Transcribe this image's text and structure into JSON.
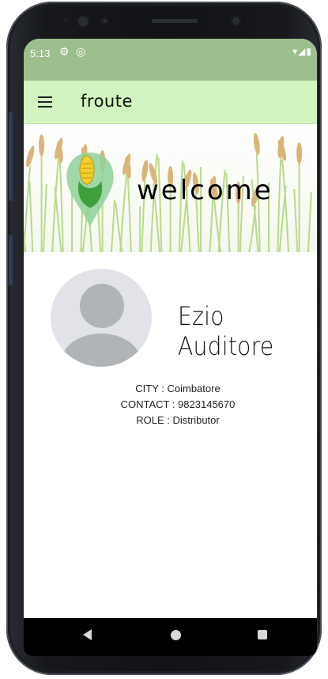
{
  "status_bar": {
    "time": "5:13",
    "icons": [
      "gear-icon",
      "sync-icon",
      "wifi-icon",
      "signal-icon",
      "battery-icon"
    ]
  },
  "app_bar": {
    "title": "froute",
    "menu_icon": "menu-icon"
  },
  "banner": {
    "text": "welcome",
    "logo_icon": "corn-pin-icon"
  },
  "profile": {
    "avatar_icon": "person-placeholder-icon",
    "name": "Ezio Auditore",
    "city": "CITY : Coimbatore",
    "contact": "CONTACT : 9823145670",
    "role": "ROLE : Distributor"
  },
  "nav_bar": {
    "icons": [
      "back-icon",
      "home-icon",
      "recents-icon"
    ]
  },
  "colors": {
    "status_bar": "#9dbe8d",
    "app_bar": "#d2f4c0",
    "avatar_bg": "#e1e3e8",
    "avatar_fg": "#b0b3b8"
  }
}
